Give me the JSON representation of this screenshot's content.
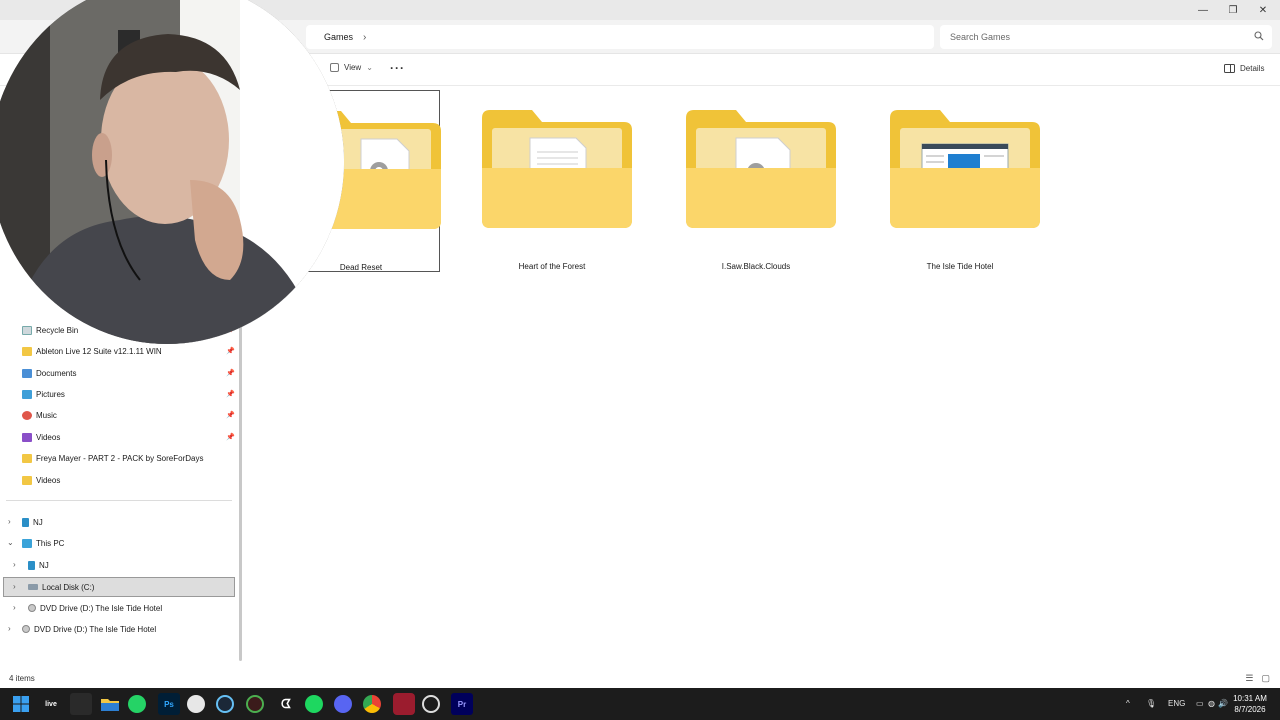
{
  "window": {
    "minimize_glyph": "—",
    "maximize_glyph": "❐",
    "close_glyph": "✕"
  },
  "address": {
    "path": "Games",
    "separator": "›",
    "search_placeholder": "Search Games"
  },
  "toolbar": {
    "view_label": "View",
    "view_caret": "⌄",
    "more_label": "···",
    "details_label": "Details"
  },
  "sidebar": {
    "quick_access": [
      {
        "label": "Recycle Bin",
        "icon": "recycle-bin-icon",
        "pinned": true
      },
      {
        "label": "Ableton Live 12 Suite v12.1.11 WIN",
        "icon": "folder-icon",
        "pinned": true
      },
      {
        "label": "Documents",
        "icon": "documents-icon",
        "pinned": true
      },
      {
        "label": "Pictures",
        "icon": "pictures-icon",
        "pinned": true
      },
      {
        "label": "Music",
        "icon": "music-icon",
        "pinned": true
      },
      {
        "label": "Videos",
        "icon": "videos-icon",
        "pinned": true
      },
      {
        "label": "Freya Mayer - PART 2 - PACK by SoreForDays",
        "icon": "folder-icon",
        "pinned": false
      },
      {
        "label": "Videos",
        "icon": "folder-icon",
        "pinned": false
      }
    ],
    "tree": [
      {
        "label": "NJ",
        "icon": "phone-icon",
        "expander": "›"
      },
      {
        "label": "This PC",
        "icon": "pc-icon",
        "expander": "⌄"
      },
      {
        "label": "NJ",
        "icon": "phone-icon",
        "expander": "›"
      },
      {
        "label": "Local Disk (C:)",
        "icon": "disk-icon",
        "expander": "›",
        "selected": true
      },
      {
        "label": "DVD Drive (D:) The Isle Tide Hotel",
        "icon": "dvd-icon",
        "expander": "›"
      },
      {
        "label": "DVD Drive (D:) The Isle Tide Hotel",
        "icon": "dvd-icon",
        "expander": "›"
      }
    ],
    "pin_glyph": "📌"
  },
  "items": [
    {
      "name": "Dead Reset",
      "selected": true,
      "preview": "gear-document"
    },
    {
      "name": "Heart of the Forest",
      "selected": false,
      "preview": "text-document"
    },
    {
      "name": "I.Saw.Black.Clouds",
      "selected": false,
      "preview": "gear-document"
    },
    {
      "name": "The Isle Tide Hotel",
      "selected": false,
      "preview": "window-screenshot"
    }
  ],
  "status": {
    "item_count": "4 items"
  },
  "taskbar": {
    "apps": [
      {
        "name": "start-icon",
        "label": ""
      },
      {
        "name": "live-app-icon",
        "label": "live"
      },
      {
        "name": "blank-app-icon",
        "label": ""
      },
      {
        "name": "file-explorer-icon",
        "label": "",
        "active": true
      },
      {
        "name": "whatsapp-icon",
        "label": ""
      },
      {
        "name": "photoshop-icon",
        "label": "Ps"
      },
      {
        "name": "browser-icon",
        "label": ""
      },
      {
        "name": "steam-icon",
        "label": ""
      },
      {
        "name": "green-app-icon",
        "label": ""
      },
      {
        "name": "capcut-icon",
        "label": ""
      },
      {
        "name": "spotify-icon",
        "label": ""
      },
      {
        "name": "discord-icon",
        "label": ""
      },
      {
        "name": "chrome-icon",
        "label": ""
      },
      {
        "name": "shield-app-icon",
        "label": ""
      },
      {
        "name": "obs-icon",
        "label": ""
      },
      {
        "name": "premiere-icon",
        "label": "Pr"
      }
    ],
    "tray": {
      "chevron": "^",
      "language": "ENG",
      "time": "10:31 AM",
      "date": "8/7/2026"
    }
  },
  "colors": {
    "folder_back": "#f0c338",
    "folder_front": "#fbd66a",
    "taskbar": "#1c1c1c",
    "selection": "#dddddd"
  }
}
